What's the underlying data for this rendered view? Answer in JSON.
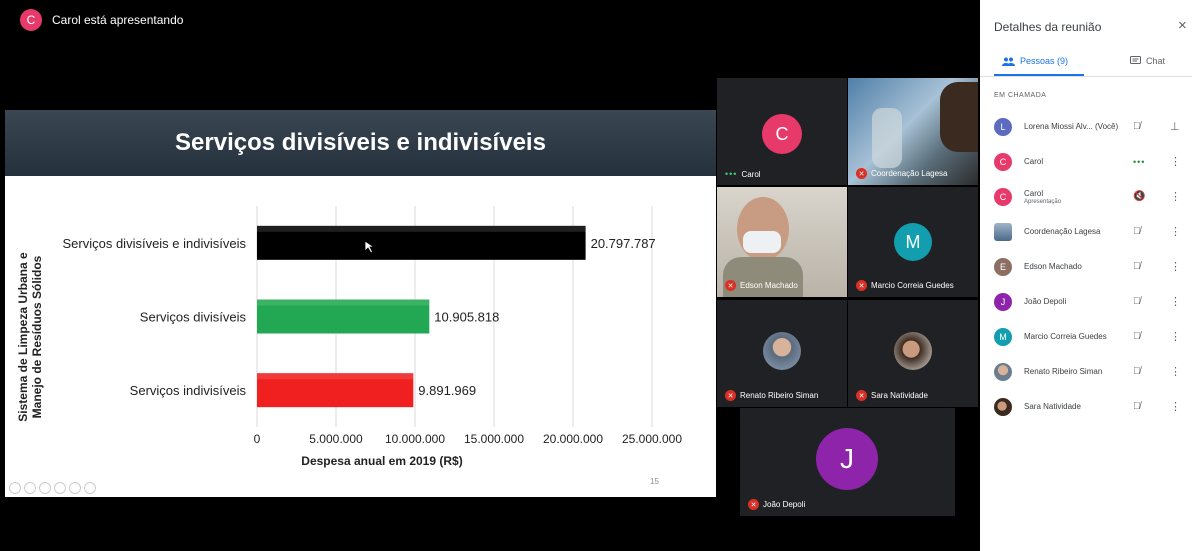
{
  "banner": {
    "avatar_letter": "C",
    "text": "Carol está apresentando"
  },
  "slide": {
    "title": "Serviços divisíveis e indivisíveis",
    "page_number": "15"
  },
  "chart_data": {
    "type": "bar",
    "orientation": "horizontal",
    "title": "Serviços divisíveis e indivisíveis",
    "categories": [
      "Serviços divisíveis e indivisíveis",
      "Serviços divisíveis",
      "Serviços indivisíveis"
    ],
    "values": [
      20797787,
      10905818,
      9891969
    ],
    "value_labels": [
      "20.797.787",
      "10.905.818",
      "9.891.969"
    ],
    "colors": [
      "#000000",
      "#22a853",
      "#f02020"
    ],
    "xlabel": "Despesa anual em 2019 (R$)",
    "ylabel_lines": [
      "Sistema de Limpeza Urbana e",
      "Manejo de Resíduos Sólidos"
    ],
    "xlim": [
      0,
      25000000
    ],
    "xticks": [
      0,
      5000000,
      10000000,
      15000000,
      20000000,
      25000000
    ],
    "xtick_labels": [
      "0",
      "5.000.000",
      "10.000.000",
      "15.000.000",
      "20.000.000",
      "25.000.000"
    ],
    "grid": true
  },
  "tiles": {
    "carol": {
      "letter": "C",
      "name": "Carol",
      "color": "#e8396b"
    },
    "coord": {
      "name": "Coordenação Lagesa"
    },
    "edson": {
      "name": "Edson Machado"
    },
    "marcio": {
      "letter": "M",
      "name": "Marcio Correia Guedes",
      "color": "#129eaf"
    },
    "renato": {
      "name": "Renato Ribeiro Siman"
    },
    "sara": {
      "name": "Sara Natividade"
    },
    "joao": {
      "letter": "J",
      "name": "João Depoli",
      "color": "#8e24aa"
    }
  },
  "panel": {
    "title": "Detalhes da reunião",
    "close_icon": "×",
    "tab_people": "Pessoas (9)",
    "tab_chat": "Chat",
    "section": "EM CHAMADA",
    "participants": [
      {
        "letter": "L",
        "color": "#5c6bc0",
        "name": "Lorena Miossi Alv...",
        "tag": "(Você)"
      },
      {
        "letter": "C",
        "color": "#e8396b",
        "name": "Carol"
      },
      {
        "letter": "C",
        "color": "#e8396b",
        "name": "Carol",
        "sub": "Apresentação"
      },
      {
        "name": "Coordenação Lagesa"
      },
      {
        "letter": "E",
        "color": "#8d6e63",
        "name": "Edson Machado"
      },
      {
        "letter": "J",
        "color": "#8e24aa",
        "name": "João Depoli"
      },
      {
        "letter": "M",
        "color": "#129eaf",
        "name": "Marcio Correia Guedes"
      },
      {
        "name": "Renato Ribeiro Siman"
      },
      {
        "name": "Sara Natividade"
      }
    ]
  }
}
